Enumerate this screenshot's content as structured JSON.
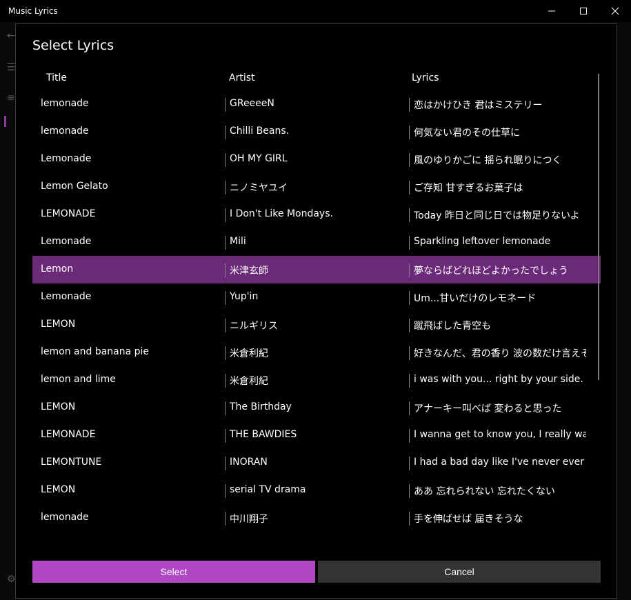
{
  "window": {
    "title": "Music Lyrics"
  },
  "dialog": {
    "title": "Select Lyrics",
    "columns": [
      "Title",
      "Artist",
      "Lyrics"
    ],
    "rows": [
      {
        "title": "lemonade",
        "artist": "GReeeeN",
        "lyrics": "恋はかけひき 君はミステリー"
      },
      {
        "title": "lemonade",
        "artist": "Chilli Beans.",
        "lyrics": "何気ない君のその仕草に"
      },
      {
        "title": "Lemonade",
        "artist": "OH MY GIRL",
        "lyrics": "風のゆりかごに 揺られ眠りにつく"
      },
      {
        "title": "Lemon Gelato",
        "artist": "ニノミヤユイ",
        "lyrics": "ご存知 甘すぎるお菓子は"
      },
      {
        "title": "LEMONADE",
        "artist": "I Don't Like Mondays.",
        "lyrics": "Today 昨日と同じ日では物足りないよ"
      },
      {
        "title": "Lemonade",
        "artist": "Mili",
        "lyrics": "Sparkling leftover lemonade"
      },
      {
        "title": "Lemon",
        "artist": "米津玄師",
        "lyrics": "夢ならばどれほどよかったでしょう"
      },
      {
        "title": "Lemonade",
        "artist": "Yup'in",
        "lyrics": "Um...甘いだけのレモネード"
      },
      {
        "title": "LEMON",
        "artist": "ニルギリス",
        "lyrics": "蹴飛ばした青空も"
      },
      {
        "title": "lemon and banana pie",
        "artist": "米倉利紀",
        "lyrics": "好きなんだ、君の香り 波の数だけ言えそう"
      },
      {
        "title": "lemon and lime",
        "artist": "米倉利紀",
        "lyrics": "i was with you... right by your side."
      },
      {
        "title": "LEMON",
        "artist": "The Birthday",
        "lyrics": "アナーキー叫べば 変わると思った"
      },
      {
        "title": "LEMONADE",
        "artist": "THE BAWDIES",
        "lyrics": "I wanna get to know you, I really wanna"
      },
      {
        "title": "LEMONTUNE",
        "artist": "INORAN",
        "lyrics": "I had a bad day like I've never ever had"
      },
      {
        "title": "LEMON",
        "artist": "serial TV drama",
        "lyrics": "ああ 忘れられない 忘れたくない"
      },
      {
        "title": "lemonade",
        "artist": "中川翔子",
        "lyrics": "手を伸ばせば 届きそうな"
      }
    ],
    "selected_index": 6,
    "select_label": "Select",
    "cancel_label": "Cancel"
  },
  "colors": {
    "accent": "#b048c4",
    "selected_row": "#6a2a78",
    "cancel_bg": "#333333"
  }
}
